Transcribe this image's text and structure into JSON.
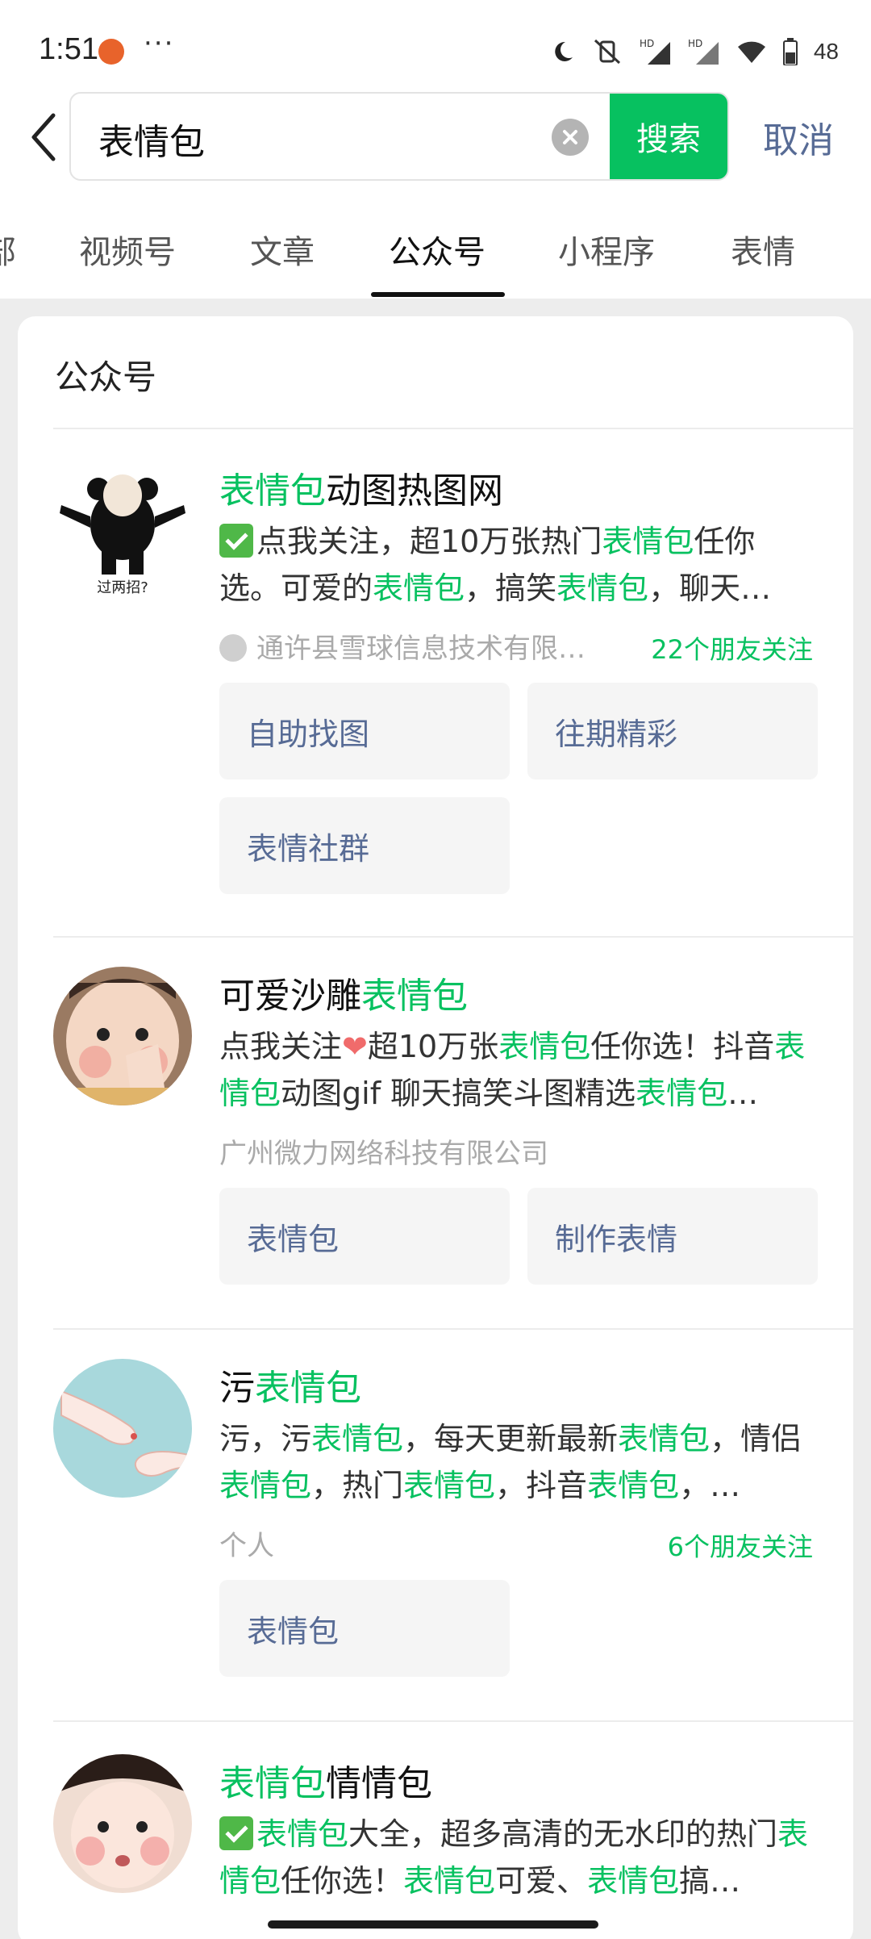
{
  "status_bar": {
    "time": "1:51",
    "dots": "···",
    "battery": "48"
  },
  "search": {
    "query": "表情包",
    "button_label": "搜索",
    "cancel_label": "取消"
  },
  "tabs": [
    {
      "label": "部",
      "active": false
    },
    {
      "label": "视频号",
      "active": false
    },
    {
      "label": "文章",
      "active": false
    },
    {
      "label": "公众号",
      "active": true
    },
    {
      "label": "小程序",
      "active": false
    },
    {
      "label": "表情",
      "active": false
    }
  ],
  "section_title": "公众号",
  "results": [
    {
      "name_highlight": "表情包",
      "name_rest": "动图热图网",
      "avatar_caption": "过两招?",
      "desc": {
        "p1": "点我关注，超10万张热门",
        "h1": "表情包",
        "p2": "任你选。可爱的",
        "h2": "表情包",
        "p3": "，搞笑",
        "h3": "表情包",
        "p4": "，聊天…"
      },
      "org": "通许县雪球信息技术有限…",
      "friends": "22个朋友关注",
      "menus": [
        "自助找图",
        "往期精彩",
        "表情社群"
      ]
    },
    {
      "name_plain": "可爱沙雕",
      "name_highlight": "表情包",
      "desc": {
        "p1": "点我关注",
        "heart": "❤",
        "p2": "超10万张",
        "h1": "表情包",
        "p3": "任你选！抖音",
        "h2": "表情包",
        "p4": "动图gif 聊天搞笑斗图精选",
        "h3": "表情包",
        "p5": "…"
      },
      "org": "广州微力网络科技有限公司",
      "menus": [
        "表情包",
        "制作表情"
      ]
    },
    {
      "name_plain": "污",
      "name_highlight": "表情包",
      "desc": {
        "p1": "污，污",
        "h1": "表情包",
        "p2": "，每天更新最新",
        "h2": "表情包",
        "p3": "，情侣",
        "h3": "表情包",
        "p4": "，热门",
        "h4": "表情包",
        "p5": "，抖音",
        "h5": "表情包",
        "p6": "，…"
      },
      "org": "个人",
      "friends": "6个朋友关注",
      "menus": [
        "表情包"
      ]
    },
    {
      "name_highlight": "表情包",
      "name_rest": "情情包",
      "desc": {
        "h1": "表情包",
        "p1": "大全，超多高清的无水印的热门",
        "h2": "表情包",
        "p2": "任你选！",
        "h3": "表情包",
        "p3": "可爱、",
        "h4": "表情包",
        "p4": "搞…"
      }
    }
  ]
}
